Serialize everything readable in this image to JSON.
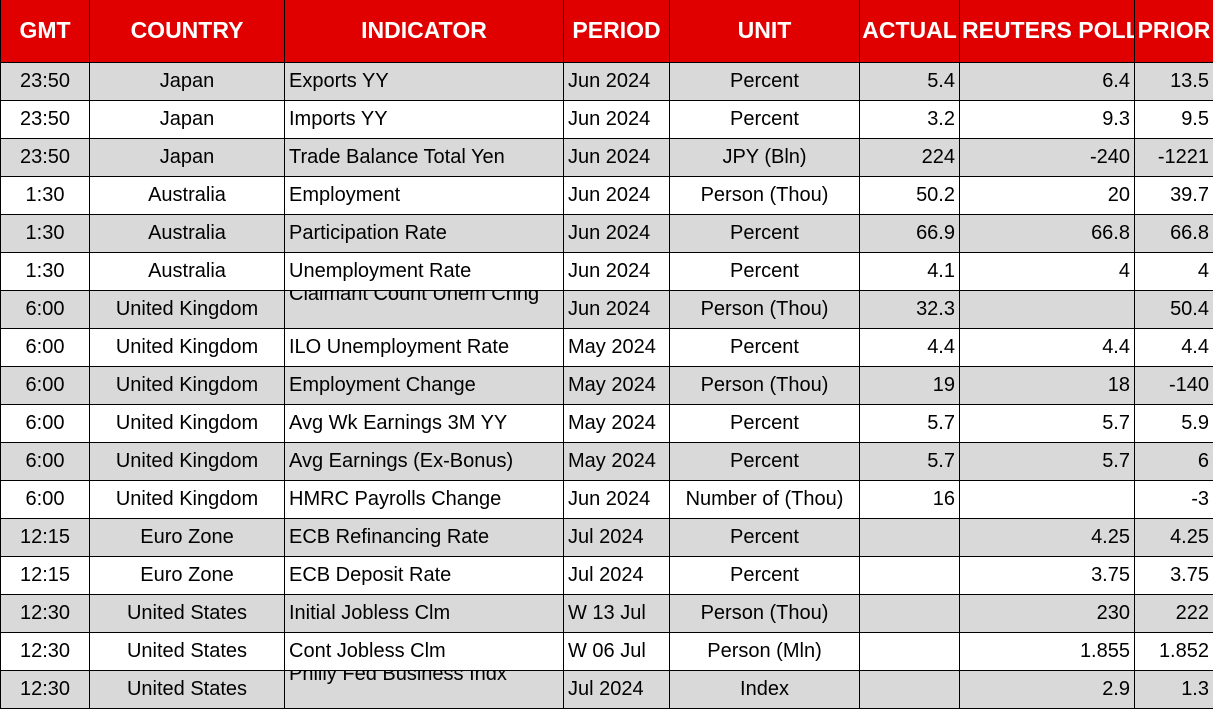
{
  "colors": {
    "header_bg": "#E00000",
    "header_text": "#FFFFFF",
    "shaded_row_bg": "#D9D9D9",
    "plain_row_bg": "#FFFFFF",
    "border": "#000000"
  },
  "table": {
    "headers": {
      "gmt": "GMT",
      "country": "COUNTRY",
      "indicator": "INDICATOR",
      "period": "PERIOD",
      "unit": "UNIT",
      "actual": "ACTUAL",
      "reuters_poll": "REUTERS POLL",
      "prior": "PRIOR"
    },
    "rows": [
      {
        "gmt": "23:50",
        "country": "Japan",
        "indicator": "Exports YY",
        "period": "Jun 2024",
        "unit": "Percent",
        "actual": "5.4",
        "reuters_poll": "6.4",
        "prior": "13.5"
      },
      {
        "gmt": "23:50",
        "country": "Japan",
        "indicator": "Imports YY",
        "period": "Jun 2024",
        "unit": "Percent",
        "actual": "3.2",
        "reuters_poll": "9.3",
        "prior": "9.5"
      },
      {
        "gmt": "23:50",
        "country": "Japan",
        "indicator": "Trade Balance Total Yen",
        "period": "Jun 2024",
        "unit": "JPY (Bln)",
        "actual": "224",
        "reuters_poll": "-240",
        "prior": "-1221"
      },
      {
        "gmt": "1:30",
        "country": "Australia",
        "indicator": "Employment",
        "period": "Jun 2024",
        "unit": "Person (Thou)",
        "actual": "50.2",
        "reuters_poll": "20",
        "prior": "39.7"
      },
      {
        "gmt": "1:30",
        "country": "Australia",
        "indicator": "Participation Rate",
        "period": "Jun 2024",
        "unit": "Percent",
        "actual": "66.9",
        "reuters_poll": "66.8",
        "prior": "66.8"
      },
      {
        "gmt": "1:30",
        "country": "Australia",
        "indicator": "Unemployment Rate",
        "period": "Jun 2024",
        "unit": "Percent",
        "actual": "4.1",
        "reuters_poll": "4",
        "prior": "4"
      },
      {
        "gmt": "6:00",
        "country": "United Kingdom",
        "indicator": "Claimant Count Unem Chng",
        "period": "Jun 2024",
        "unit": "Person (Thou)",
        "actual": "32.3",
        "reuters_poll": "",
        "prior": "50.4"
      },
      {
        "gmt": "6:00",
        "country": "United Kingdom",
        "indicator": "ILO Unemployment Rate",
        "period": "May 2024",
        "unit": "Percent",
        "actual": "4.4",
        "reuters_poll": "4.4",
        "prior": "4.4"
      },
      {
        "gmt": "6:00",
        "country": "United Kingdom",
        "indicator": "Employment Change",
        "period": "May 2024",
        "unit": "Person (Thou)",
        "actual": "19",
        "reuters_poll": "18",
        "prior": "-140"
      },
      {
        "gmt": "6:00",
        "country": "United Kingdom",
        "indicator": "Avg Wk Earnings 3M YY",
        "period": "May 2024",
        "unit": "Percent",
        "actual": "5.7",
        "reuters_poll": "5.7",
        "prior": "5.9"
      },
      {
        "gmt": "6:00",
        "country": "United Kingdom",
        "indicator": "Avg Earnings (Ex-Bonus)",
        "period": "May 2024",
        "unit": "Percent",
        "actual": "5.7",
        "reuters_poll": "5.7",
        "prior": "6"
      },
      {
        "gmt": "6:00",
        "country": "United Kingdom",
        "indicator": "HMRC Payrolls Change",
        "period": "Jun 2024",
        "unit": "Number of (Thou)",
        "actual": "16",
        "reuters_poll": "",
        "prior": "-3"
      },
      {
        "gmt": "12:15",
        "country": "Euro Zone",
        "indicator": "ECB Refinancing Rate",
        "period": "Jul 2024",
        "unit": "Percent",
        "actual": "",
        "reuters_poll": "4.25",
        "prior": "4.25"
      },
      {
        "gmt": "12:15",
        "country": "Euro Zone",
        "indicator": "ECB Deposit Rate",
        "period": "Jul 2024",
        "unit": "Percent",
        "actual": "",
        "reuters_poll": "3.75",
        "prior": "3.75"
      },
      {
        "gmt": "12:30",
        "country": "United States",
        "indicator": "Initial Jobless Clm",
        "period": "W 13 Jul",
        "unit": "Person (Thou)",
        "actual": "",
        "reuters_poll": "230",
        "prior": "222"
      },
      {
        "gmt": "12:30",
        "country": "United States",
        "indicator": "Cont Jobless Clm",
        "period": "W 06 Jul",
        "unit": "Person (Mln)",
        "actual": "",
        "reuters_poll": "1.855",
        "prior": "1.852"
      },
      {
        "gmt": "12:30",
        "country": "United States",
        "indicator": "Philly Fed Business Indx",
        "period": "Jul 2024",
        "unit": "Index",
        "actual": "",
        "reuters_poll": "2.9",
        "prior": "1.3"
      }
    ]
  }
}
